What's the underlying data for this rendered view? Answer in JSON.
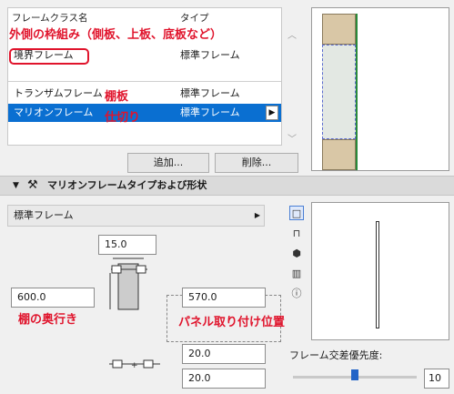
{
  "list": {
    "col_name": "フレームクラス名",
    "col_type": "タイプ",
    "rows": [
      {
        "name": "境界フレーム",
        "type": "標準フレーム"
      },
      {
        "name": "トランザムフレーム",
        "type": "標準フレーム"
      },
      {
        "name": "マリオンフレーム",
        "type": "標準フレーム"
      }
    ]
  },
  "buttons": {
    "add": "追加...",
    "delete": "削除..."
  },
  "section": {
    "title": "マリオンフレームタイプおよび形状"
  },
  "dropdown": {
    "value": "標準フレーム"
  },
  "fields": {
    "width": "15.0",
    "depth": "600.0",
    "panel_offset": "570.0",
    "offset1": "20.0",
    "offset2": "20.0"
  },
  "priority": {
    "label": "フレーム交差優先度:",
    "value": "10",
    "slider_fraction": 0.5
  },
  "annotations": {
    "outer_frame": "外側の枠組み（側板、上板、底板など）",
    "shelf": "棚板",
    "divider": "仕切り",
    "shelf_depth": "棚の奥行き",
    "panel_position": "パネル取り付け位置"
  },
  "colors": {
    "selection": "#0a6fd1",
    "annotation": "#e0142c",
    "frame_fill": "#d9c7a6",
    "green_line": "#2a8a3a"
  }
}
